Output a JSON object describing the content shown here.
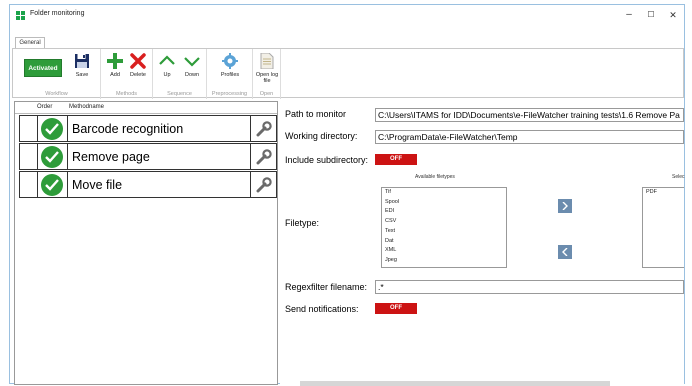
{
  "window": {
    "title": "Folder monitoring",
    "minimize": "–",
    "maximize": "☐",
    "close": "✕"
  },
  "tabs": [
    {
      "label": "General",
      "active": true
    }
  ],
  "ribbon": {
    "workflow": {
      "activated_label": "Activated",
      "save_label": "Save",
      "group_label": "Workflow"
    },
    "methods": {
      "add_label": "Add",
      "delete_label": "Delete",
      "group_label": "Methods"
    },
    "sequence": {
      "up_label": "Up",
      "down_label": "Down",
      "group_label": "Sequence"
    },
    "preprocessing": {
      "profiles_label": "Profiles",
      "group_label": "Preprocessing"
    },
    "open": {
      "open_log_label": "Open log file",
      "group_label": "Open"
    }
  },
  "method_grid": {
    "columns": [
      "Order",
      "Methodname"
    ],
    "rows": [
      {
        "name": "Barcode recognition",
        "active": true
      },
      {
        "name": "Remove page",
        "active": true
      },
      {
        "name": "Move file",
        "active": true
      }
    ]
  },
  "settings": {
    "path_label": "Path to monitor",
    "path_value": "C:\\Users\\ITAMS for IDD\\Documents\\e-FileWatcher training tests\\1.6 Remove Pa",
    "working_label": "Working directory:",
    "working_value": "C:\\ProgramData\\e-FileWatcher\\Temp",
    "subdir_label": "Include subdirectory:",
    "subdir_toggle": "OFF",
    "filetype_label": "Filetype:",
    "available_caption": "Available filetypes",
    "selected_caption": "Selec",
    "available_types": [
      "Tif",
      "Spool",
      "EDI",
      "CSV",
      "Text",
      "Dat",
      "XML",
      "Jpeg"
    ],
    "selected_types": [
      "PDF"
    ],
    "regex_label": "Regexfilter filename:",
    "regex_value": ".*",
    "notify_label": "Send notifications:",
    "notify_toggle": "OFF"
  },
  "colors": {
    "accent_green": "#2e9c3a",
    "toggle_red": "#cc1313",
    "delete_red": "#d91f1f",
    "arrow_blue": "#6b8cae"
  },
  "icons": {
    "save": "floppy-disk-icon",
    "add": "plus-icon",
    "delete": "x-icon",
    "up": "chevron-up-icon",
    "down": "chevron-down-icon",
    "profiles": "gear-icon",
    "open_log": "document-icon",
    "check": "check-circle-icon",
    "wrench": "wrench-icon"
  }
}
